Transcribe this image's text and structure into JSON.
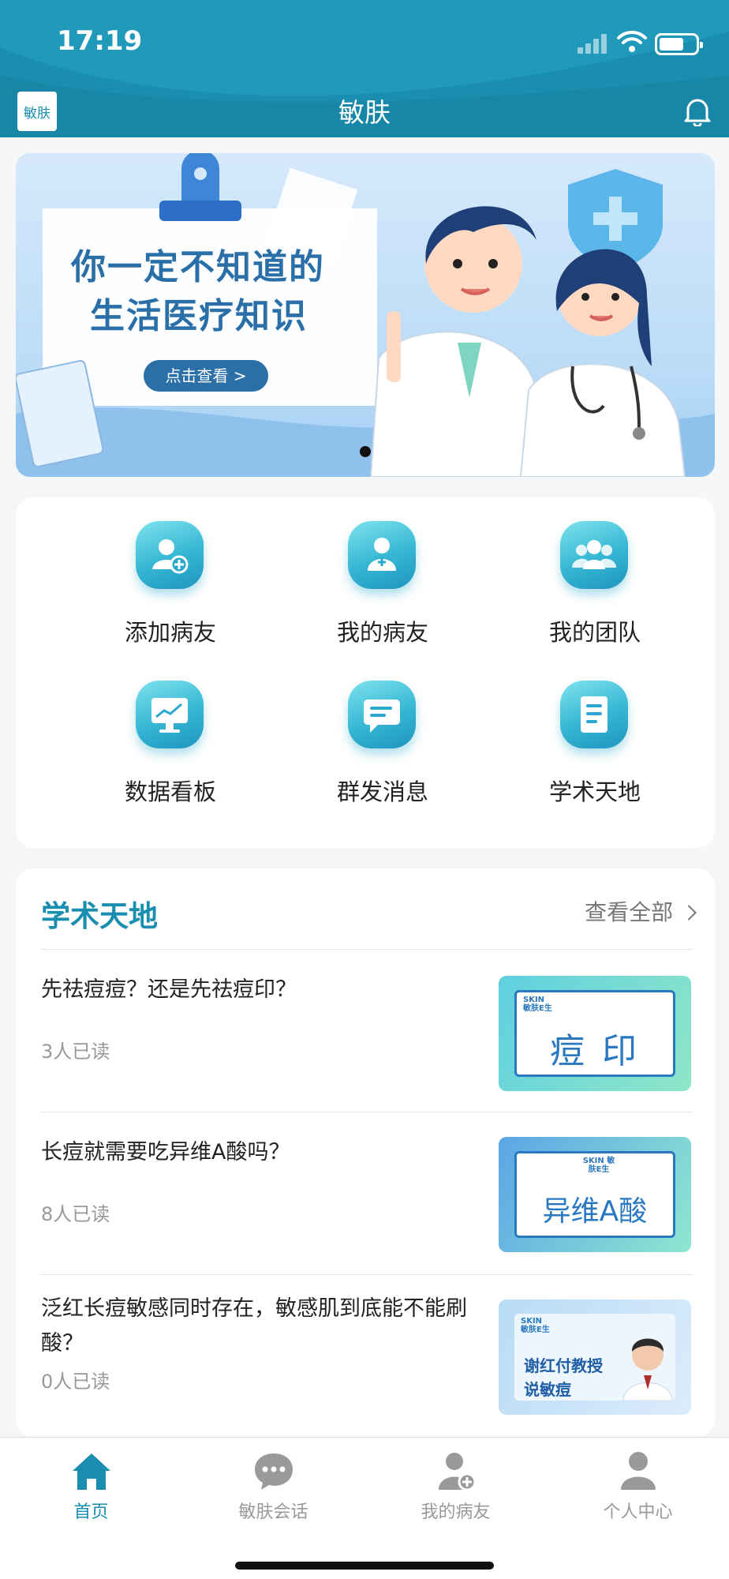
{
  "status_bar": {
    "time": "17:19"
  },
  "nav": {
    "logo_text": "敏肤",
    "title": "敏肤"
  },
  "banner": {
    "headline_line1": "你一定不知道的",
    "headline_line2": "生活医疗知识",
    "button_label": "点击查看 >"
  },
  "grid": {
    "items": [
      {
        "label": "添加病友",
        "icon": "add-patient-icon"
      },
      {
        "label": "我的病友",
        "icon": "patient-icon"
      },
      {
        "label": "我的团队",
        "icon": "team-icon"
      },
      {
        "label": "数据看板",
        "icon": "dashboard-icon"
      },
      {
        "label": "群发消息",
        "icon": "message-icon"
      },
      {
        "label": "学术天地",
        "icon": "document-icon"
      }
    ]
  },
  "academic": {
    "section_title": "学术天地",
    "view_all": "查看全部",
    "articles": [
      {
        "title": "先祛痘痘？还是先祛痘印？",
        "reads": "3人已读",
        "thumb_text": "痘 印",
        "thumb_brand": "SKIN 敏肤E生"
      },
      {
        "title": "长痘就需要吃异维A酸吗？",
        "reads": "8人已读",
        "thumb_text": "异维A酸",
        "thumb_brand": "SKIN 敏肤E生"
      },
      {
        "title": "泛红长痘敏感同时存在，敏感肌到底能不能刷酸？",
        "reads": "0人已读",
        "thumb_text_line1": "谢红付教授",
        "thumb_text_line2": "说敏痘",
        "thumb_brand": "SKIN 敏肤E生"
      }
    ]
  },
  "tabbar": {
    "tabs": [
      {
        "label": "首页",
        "icon": "home-icon",
        "active": true
      },
      {
        "label": "敏肤会话",
        "icon": "chat-icon",
        "active": false
      },
      {
        "label": "我的病友",
        "icon": "patients-icon",
        "active": false
      },
      {
        "label": "个人中心",
        "icon": "profile-icon",
        "active": false
      }
    ]
  },
  "colors": {
    "primary": "#1a8eae",
    "inactive_tab": "#999999",
    "tile_gradient_start": "#7fe3ee",
    "tile_gradient_end": "#1f95bf"
  }
}
